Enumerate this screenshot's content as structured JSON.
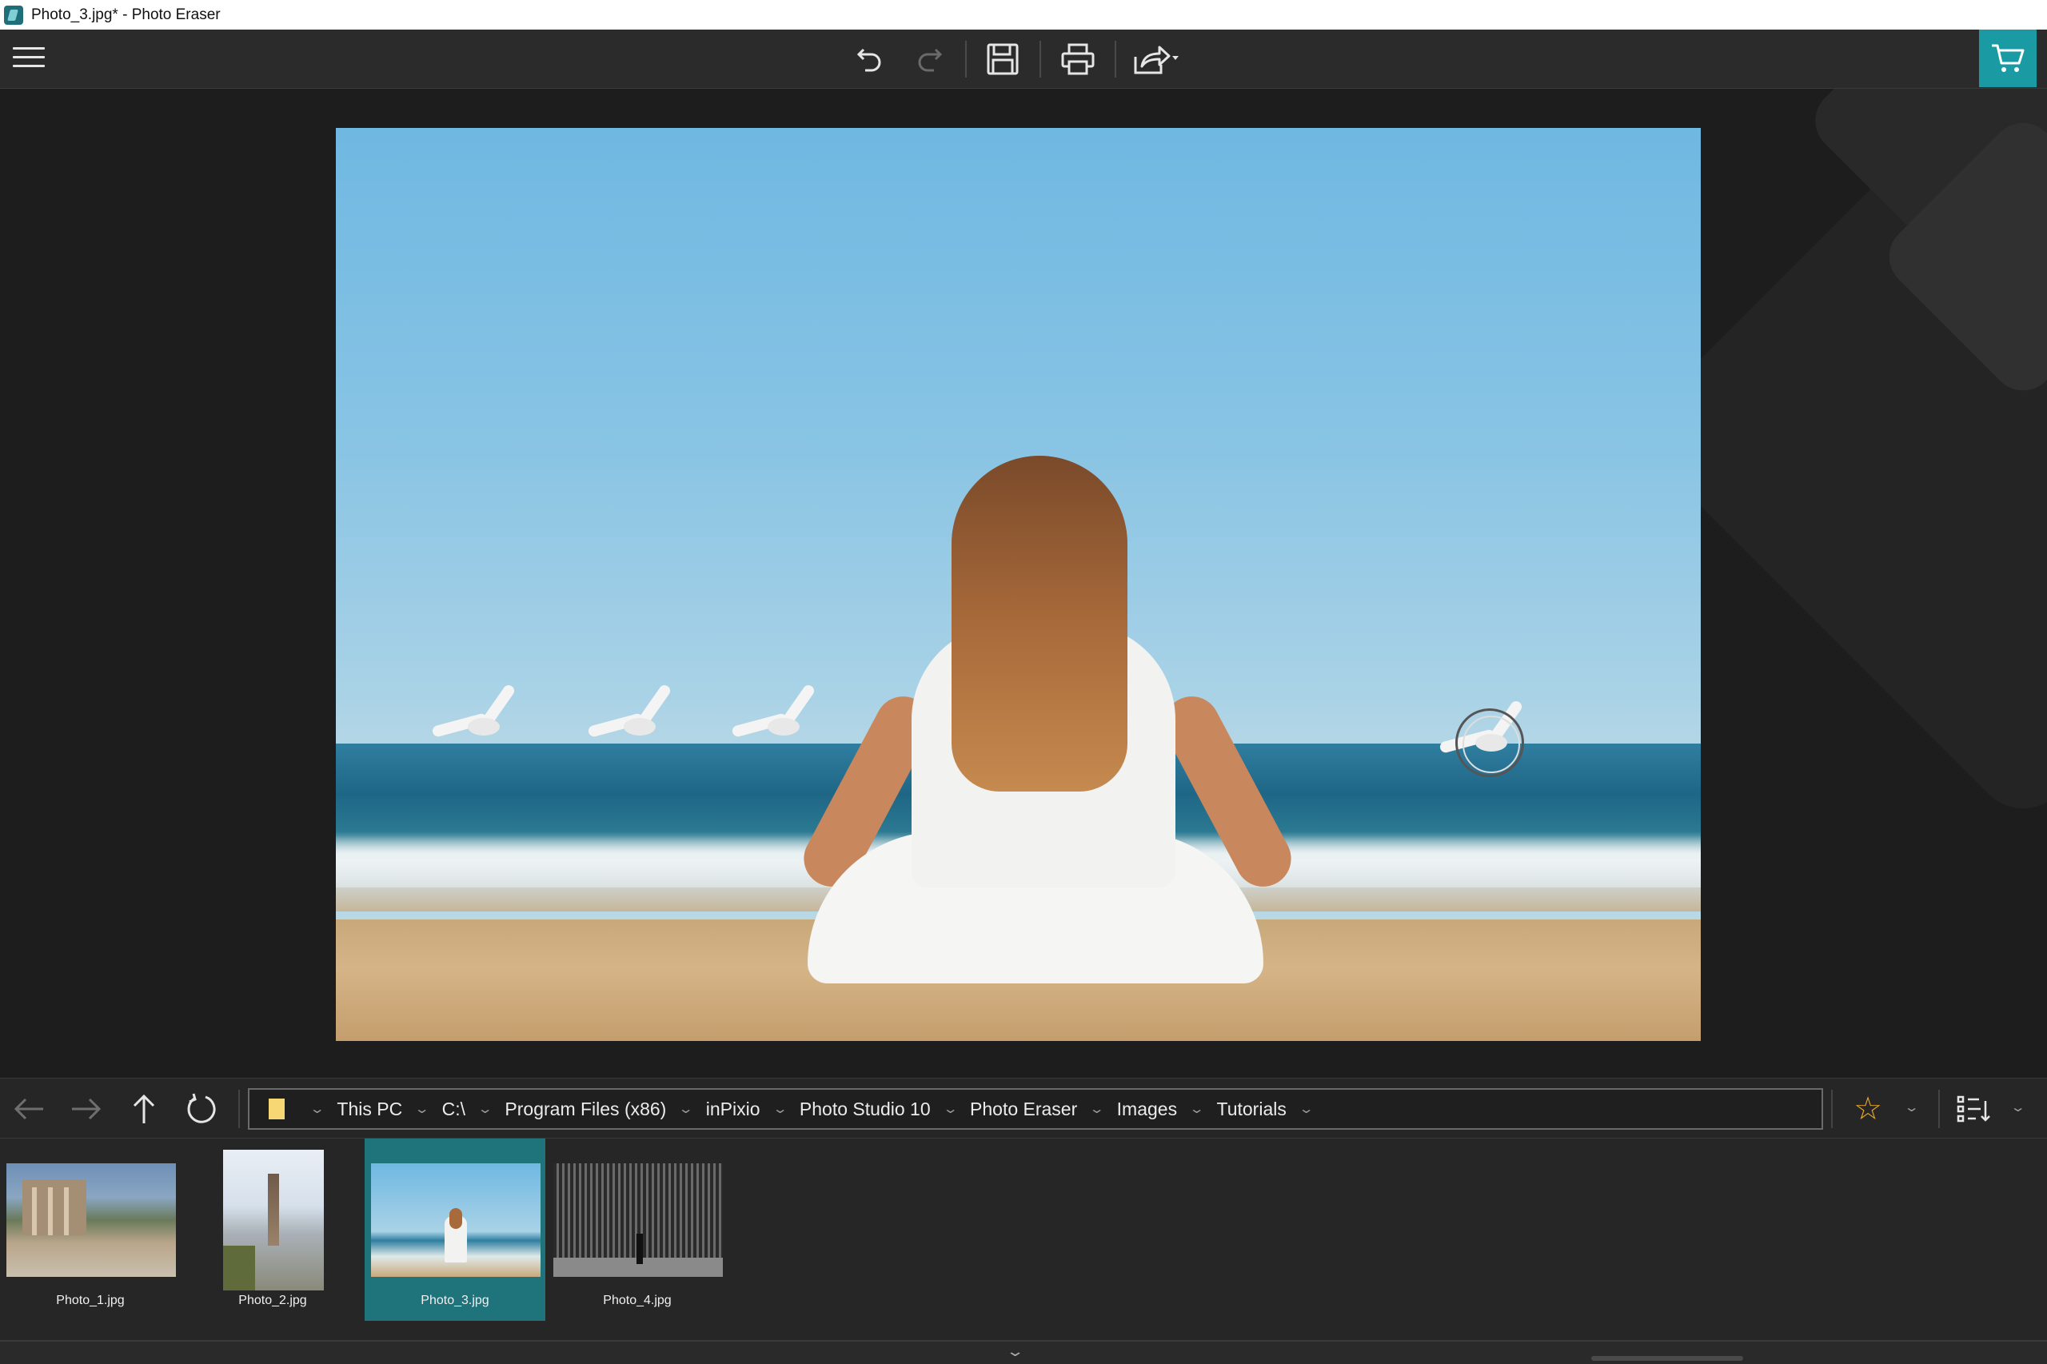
{
  "window": {
    "title": "Photo_3.jpg* - Photo Eraser"
  },
  "toolbar": {
    "menu_icon": "hamburger-icon",
    "undo_icon": "undo-icon",
    "redo_icon": "redo-icon",
    "save_icon": "save-icon",
    "print_icon": "print-icon",
    "share_icon": "share-icon",
    "cart_icon": "cart-icon",
    "accent_color": "#1a9aa3"
  },
  "navigation": {
    "back_icon": "arrow-left-icon",
    "forward_icon": "arrow-right-icon",
    "up_icon": "arrow-up-icon",
    "refresh_icon": "refresh-icon",
    "breadcrumbs": [
      "This PC",
      "C:\\",
      "Program Files (x86)",
      "inPixio",
      "Photo Studio 10",
      "Photo Eraser",
      "Images",
      "Tutorials"
    ],
    "favorite_icon": "star-icon",
    "view_icon": "list-view-icon"
  },
  "filmstrip": {
    "items": [
      {
        "name": "Photo_1.jpg",
        "selected": false
      },
      {
        "name": "Photo_2.jpg",
        "selected": false
      },
      {
        "name": "Photo_3.jpg",
        "selected": true
      },
      {
        "name": "Photo_4.jpg",
        "selected": false
      }
    ]
  }
}
